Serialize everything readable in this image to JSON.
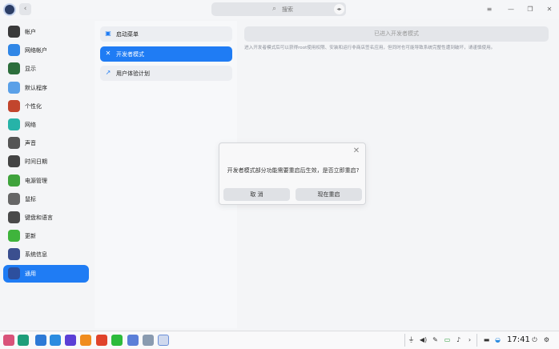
{
  "titlebar": {
    "back_icon": "‹",
    "search_icon": "⌕",
    "search_placeholder": "搜索",
    "voice_icon": "◂▸",
    "menu_icon": "≡",
    "minimize_icon": "—",
    "maximize_icon": "❐",
    "close_icon": "✕"
  },
  "sidebar": {
    "items": [
      {
        "label": "帐户",
        "icon": "account-icon",
        "color": "#3a3a3a"
      },
      {
        "label": "网络帐户",
        "icon": "cloud-icon",
        "color": "#2f86e6"
      },
      {
        "label": "显示",
        "icon": "display-icon",
        "color": "#2c6e3c"
      },
      {
        "label": "默认程序",
        "icon": "default-apps-icon",
        "color": "#5aa0e8"
      },
      {
        "label": "个性化",
        "icon": "personalization-icon",
        "color": "#c2452d"
      },
      {
        "label": "网络",
        "icon": "network-icon",
        "color": "#27b3a8"
      },
      {
        "label": "声音",
        "icon": "sound-icon",
        "color": "#555555"
      },
      {
        "label": "时间日期",
        "icon": "clock-icon",
        "color": "#444444"
      },
      {
        "label": "电源管理",
        "icon": "battery-icon",
        "color": "#3fa33c"
      },
      {
        "label": "鼠标",
        "icon": "mouse-icon",
        "color": "#666666"
      },
      {
        "label": "键盘和语言",
        "icon": "keyboard-icon",
        "color": "#4a4a4a"
      },
      {
        "label": "更新",
        "icon": "update-icon",
        "color": "#3fb43c"
      },
      {
        "label": "系统信息",
        "icon": "system-info-icon",
        "color": "#3b4f8f"
      },
      {
        "label": "通用",
        "icon": "general-icon",
        "color": "#2d4f9e"
      }
    ],
    "active_index": 13
  },
  "general_menu": {
    "items": [
      {
        "label": "启动菜单",
        "icon": "▣"
      },
      {
        "label": "开发者模式",
        "icon": "✕"
      },
      {
        "label": "用户体验计划",
        "icon": "↗"
      }
    ],
    "active_index": 1
  },
  "developer": {
    "status_button": "已进入开发者模式",
    "description": "进入开发者模式后可以获得root使用权限、安装和运行非商店签名应用，但同时也可能导致系统完整性遭到破坏，请谨慎使用。"
  },
  "dialog": {
    "close_icon": "✕",
    "message": "开发者模式部分功能需要重启后生效，是否立即重启?",
    "cancel_label": "取 消",
    "confirm_label": "现在重启"
  },
  "taskbar": {
    "apps": [
      {
        "name": "launcher-icon",
        "color": "#d9537a"
      },
      {
        "name": "terminal-icon",
        "color": "#1e9e7a"
      },
      {
        "name": "file-manager-icon",
        "color": "#2e7ad6"
      },
      {
        "name": "store-icon",
        "color": "#2b8ce0"
      },
      {
        "name": "browser-icon",
        "color": "#5b3fd6"
      },
      {
        "name": "app-store-icon",
        "color": "#f08c1e"
      },
      {
        "name": "music-icon",
        "color": "#e0432b"
      },
      {
        "name": "wechat-icon",
        "color": "#2dbb3c"
      },
      {
        "name": "document-viewer-icon",
        "color": "#5b7fd8"
      },
      {
        "name": "text-editor-icon",
        "color": "#8a9bb0"
      },
      {
        "name": "control-center-icon",
        "color": "#2c3e66"
      }
    ],
    "active_app_index": 10,
    "tray": {
      "usb": "⏚",
      "volume": "◀)",
      "pen": "✎",
      "battery": "▭",
      "bell": "♪",
      "expand": "›",
      "input": "▬",
      "network": "◒"
    },
    "clock": "17:41",
    "power_icon": "⏻",
    "settings_icon": "⚙"
  }
}
